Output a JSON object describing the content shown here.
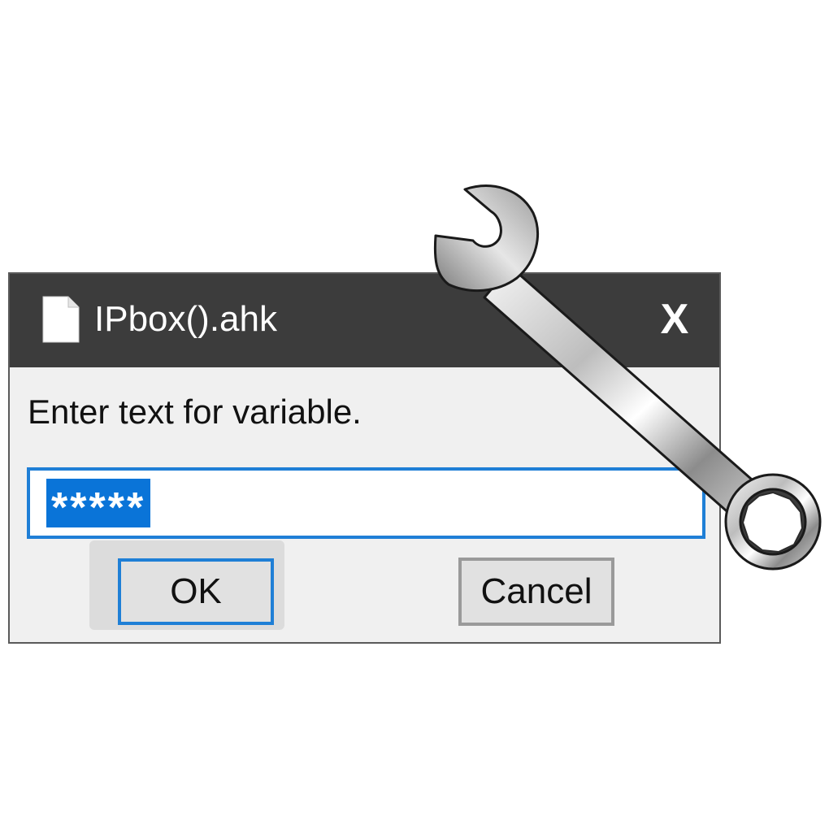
{
  "window": {
    "title": "IPbox().ahk",
    "title_icon": "file-icon",
    "close_label": "X"
  },
  "dialog": {
    "prompt": "Enter text for variable.",
    "input_value": "*****",
    "ok_label": "OK",
    "cancel_label": "Cancel"
  },
  "overlay": {
    "icon": "wrench-icon"
  },
  "colors": {
    "titlebar": "#3c3c3c",
    "dialog_bg": "#f0f0f0",
    "accent": "#1f7fd6",
    "selection": "#0a74d8",
    "button_bg": "#e1e1e1"
  }
}
